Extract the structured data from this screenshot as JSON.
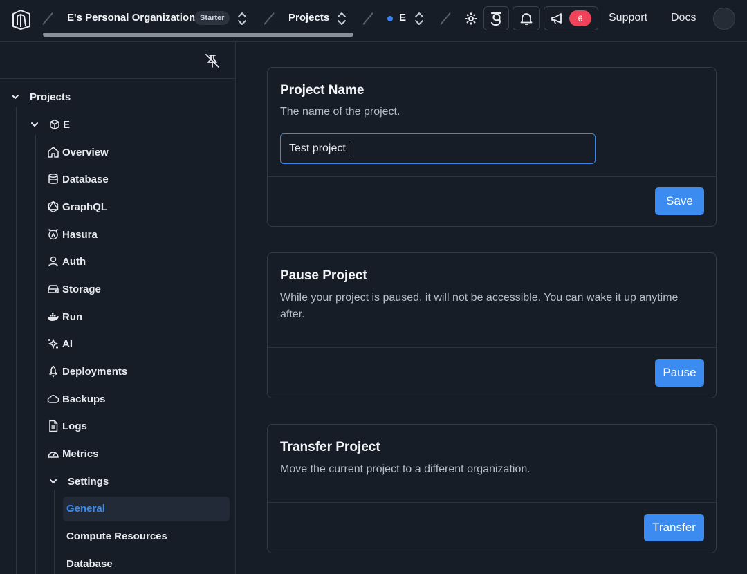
{
  "topbar": {
    "org_name": "E's Personal Organization",
    "plan_badge": "Starter",
    "projects_label": "Projects",
    "project_name": "E",
    "notification_count": "6",
    "support_label": "Support",
    "docs_label": "Docs"
  },
  "sidebar": {
    "root_label": "Projects",
    "project_label": "E",
    "items": [
      {
        "label": "Overview",
        "icon": "home-icon"
      },
      {
        "label": "Database",
        "icon": "database-icon"
      },
      {
        "label": "GraphQL",
        "icon": "graphql-icon"
      },
      {
        "label": "Hasura",
        "icon": "hasura-icon"
      },
      {
        "label": "Auth",
        "icon": "user-icon"
      },
      {
        "label": "Storage",
        "icon": "storage-icon"
      },
      {
        "label": "Run",
        "icon": "whale-icon"
      },
      {
        "label": "AI",
        "icon": "sparkles-icon"
      },
      {
        "label": "Deployments",
        "icon": "rocket-icon"
      },
      {
        "label": "Backups",
        "icon": "cloud-icon"
      },
      {
        "label": "Logs",
        "icon": "file-icon"
      },
      {
        "label": "Metrics",
        "icon": "gauge-icon"
      }
    ],
    "settings_label": "Settings",
    "settings_items": [
      {
        "label": "General",
        "active": true
      },
      {
        "label": "Compute Resources",
        "active": false
      },
      {
        "label": "Database",
        "active": false
      }
    ]
  },
  "main": {
    "project_name_card": {
      "title": "Project Name",
      "description": "The name of the project.",
      "input_value": "Test project",
      "button": "Save"
    },
    "pause_card": {
      "title": "Pause Project",
      "description": "While your project is paused, it will not be accessible. You can wake it up anytime after.",
      "button": "Pause"
    },
    "transfer_card": {
      "title": "Transfer Project",
      "description": "Move the current project to a different organization.",
      "button": "Transfer"
    }
  },
  "colors": {
    "background": "#171d26",
    "accent": "#3b8bf0",
    "badge_red": "#f0435a",
    "active_item": "#3b8bf0"
  }
}
